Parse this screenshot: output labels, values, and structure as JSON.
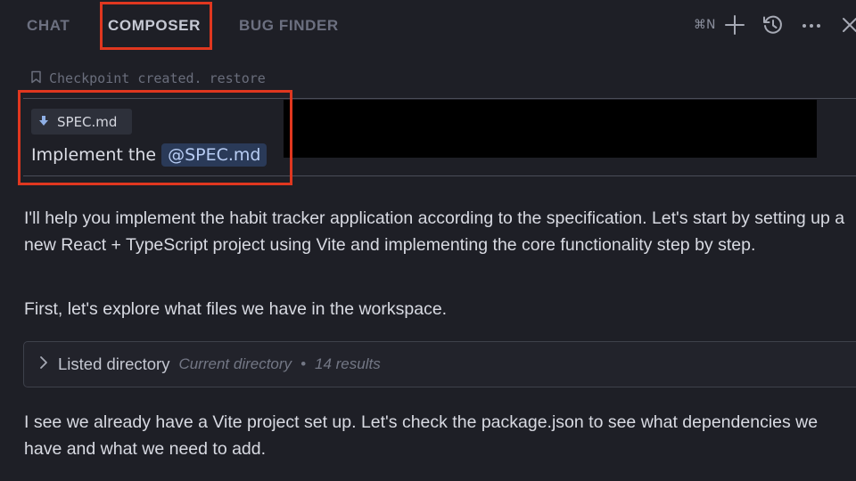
{
  "tabs": [
    {
      "label": "CHAT"
    },
    {
      "label": "COMPOSER"
    },
    {
      "label": "BUG FINDER"
    }
  ],
  "toolbar": {
    "shortcut": "⌘N",
    "icons": [
      "plus-icon",
      "history-icon",
      "more-icon",
      "close-icon"
    ]
  },
  "checkpoint": {
    "text": "Checkpoint created.",
    "restore_label": "restore"
  },
  "user_message": {
    "attachment": {
      "icon": "download-arrow-icon",
      "name": "SPEC.md"
    },
    "text": "Implement the",
    "mention": "@SPEC.md"
  },
  "assistant": {
    "para1": "I'll help you implement the habit tracker application according to the specification. Let's start by setting up a new React + TypeScript project using Vite and implementing the core functionality step by step.",
    "para2": "First, let's explore what files we have in the workspace.",
    "tool": {
      "title": "Listed directory",
      "location": "Current directory",
      "separator": "•",
      "results": "14 results"
    },
    "para3": "I see we already have a Vite project set up. Let's check the package.json to see what dependencies we have and what we need to add."
  },
  "colors": {
    "background": "#1e1f26",
    "highlight": "#e0371f",
    "mention_bg": "#2a3a58",
    "mention_text": "#b8cdf4"
  }
}
